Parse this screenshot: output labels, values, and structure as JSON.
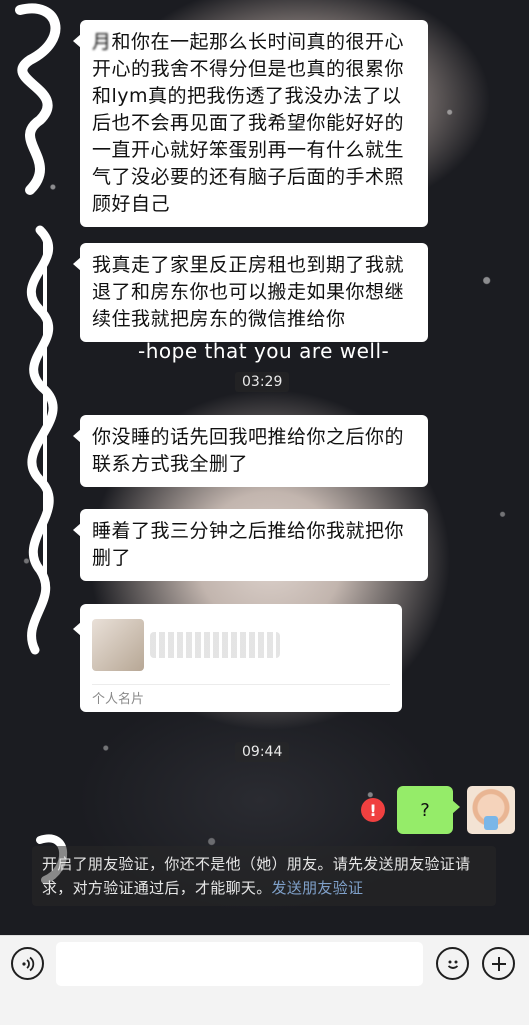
{
  "messages": {
    "m1": "和你在一起那么长时间真的很开心开心的我舍不得分但是也真的很累你和lym真的把我伤透了我没办法了以后也不会再见面了我希望你能好好的一直开心就好笨蛋别再一有什么就生气了没必要的还有脑子后面的手术照顾好自己",
    "m1_prefix": "月",
    "m2": "我真走了家里反正房租也到期了我就退了和房东你也可以搬走如果你想继续住我就把房东的微信推给你",
    "m3": "你没睡的话先回我吧推给你之后你的联系方式我全删了",
    "m4": "睡着了我三分钟之后推给你我就把你删了",
    "my_message": "?"
  },
  "wallpaper_caption": "-hope that you are well-",
  "timestamps": {
    "t1": "03:29",
    "t2": "09:44"
  },
  "contact_card": {
    "label": "个人名片"
  },
  "system_note": {
    "text": "开启了朋友验证，你还不是他（她）朋友。请先发送朋友验证请求，对方验证通过后，才能聊天。",
    "link": "发送朋友验证"
  },
  "input": {
    "placeholder": ""
  },
  "icons": {
    "voice": "voice-icon",
    "emoji": "emoji-icon",
    "plus": "plus-icon",
    "error": "error-icon"
  },
  "colors": {
    "my_bubble": "#95ec69",
    "their_bubble": "#ffffff",
    "error": "#f04040",
    "link": "#7fa0c9"
  }
}
